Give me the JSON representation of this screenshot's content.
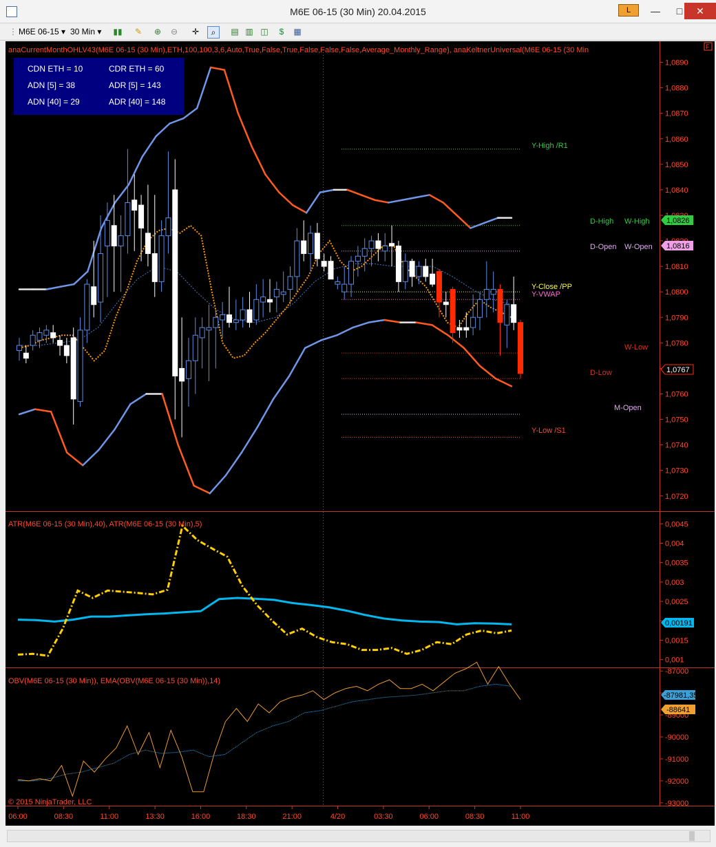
{
  "window": {
    "title": "M6E 06-15 (30 Min)  20.04.2015",
    "minimize": "—",
    "maximize": "□",
    "close": "✕",
    "lock_label": "L"
  },
  "toolbar": {
    "instrument": "M6E 06-15",
    "interval": "30 Min"
  },
  "legend": {
    "price": "anaCurrentMonthOHLV43(M6E  06-15 (30 Min),ETH,100,100,3,6,Auto,True,False,True,False,False,False,Average_Monthly_Range), anaKeltnerUniversal(M6E  06-15 (30 Min",
    "atr": "ATR(M6E 06-15 (30 Min),40), ATR(M6E 06-15 (30 Min),5)",
    "obv": "OBV(M6E 06-15 (30 Min)), EMA(OBV(M6E 06-15 (30 Min)),14)",
    "copyright": "© 2015 NinjaTrader, LLC",
    "f_box": "F"
  },
  "info_box": {
    "cdn_eth": "CDN ETH = 10",
    "cdr_eth": "CDR ETH = 60",
    "adn5": "ADN [5] = 38",
    "adr5": "ADR [5] = 143",
    "adn40": "ADN [40] = 29",
    "adr40": "ADR [40] = 148"
  },
  "level_labels": {
    "y_high": "Y-High /R1",
    "d_high": "D-High",
    "w_high": "W-High",
    "d_open": "D-Open",
    "w_open": "W-Open",
    "y_close": "Y-Close /PP",
    "y_vwap": "Y-VWAP",
    "w_low": "W-Low",
    "d_low": "D-Low",
    "m_open": "M-Open",
    "y_low": "Y-Low /S1"
  },
  "price_tags": {
    "high": "1,0826",
    "open": "1,0816",
    "last": "1,0767"
  },
  "atr_tag": "0,00191",
  "obv_tags": {
    "obv": "-88641",
    "ema": "-87981,35"
  },
  "colors": {
    "background": "#000000",
    "bull_candle": "#5b8ee6",
    "bear_candle": "#ffffff",
    "red_candle": "#ff2a00",
    "keltner_up": "#6f96e8",
    "keltner_down": "#ff5a20",
    "keltner_neutral": "#e8e8e8",
    "atr40": "#00b8f0",
    "atr5": "#ffd000",
    "obv": "#e89a30",
    "obv_ema": "#3aa0d8",
    "separator": "#c0392b"
  },
  "chart_data": [
    {
      "type": "candlestick",
      "title": "M6E 06-15 (30 Min)",
      "x_tick_labels": [
        "06:00",
        "08:30",
        "11:00",
        "13:30",
        "16:00",
        "18:30",
        "21:00",
        "4/20",
        "03:30",
        "06:00",
        "08:30",
        "11:00"
      ],
      "y_ticks": [
        "1,0890",
        "1,0880",
        "1,0870",
        "1,0860",
        "1,0850",
        "1,0840",
        "1,0830",
        "1,0820",
        "1,0810",
        "1,0800",
        "1,0790",
        "1,0780",
        "1,0770",
        "1,0760",
        "1,0750",
        "1,0740",
        "1,0730",
        "1,0720"
      ],
      "ylim": [
        1.0714,
        1.0895
      ],
      "candles_ohlc": [
        [
          1.0777,
          1.0782,
          1.0773,
          1.0779
        ],
        [
          1.0776,
          1.0779,
          1.0772,
          1.0774
        ],
        [
          1.0779,
          1.0785,
          1.0777,
          1.0783
        ],
        [
          1.0781,
          1.0786,
          1.0778,
          1.0784
        ],
        [
          1.0783,
          1.0787,
          1.078,
          1.0785
        ],
        [
          1.0784,
          1.0787,
          1.078,
          1.0782
        ],
        [
          1.0781,
          1.0783,
          1.0775,
          1.0779
        ],
        [
          1.0779,
          1.0782,
          1.0772,
          1.0775
        ],
        [
          1.0782,
          1.0786,
          1.0748,
          1.0758
        ],
        [
          1.0757,
          1.079,
          1.0755,
          1.0785
        ],
        [
          1.0785,
          1.0805,
          1.078,
          1.0803
        ],
        [
          1.0802,
          1.082,
          1.079,
          1.0795
        ],
        [
          1.0796,
          1.083,
          1.0788,
          1.0815
        ],
        [
          1.0818,
          1.0835,
          1.0798,
          1.0828
        ],
        [
          1.0826,
          1.0838,
          1.08,
          1.0818
        ],
        [
          1.0818,
          1.083,
          1.08,
          1.0822
        ],
        [
          1.0822,
          1.0856,
          1.0815,
          1.0835
        ],
        [
          1.0836,
          1.0846,
          1.0816,
          1.0832
        ],
        [
          1.0834,
          1.0838,
          1.0812,
          1.0825
        ],
        [
          1.0823,
          1.0842,
          1.081,
          1.0815
        ],
        [
          1.0815,
          1.0838,
          1.0798,
          1.0804
        ],
        [
          1.0804,
          1.0828,
          1.08,
          1.0822
        ],
        [
          1.0822,
          1.0855,
          1.0815,
          1.0829
        ],
        [
          1.084,
          1.0852,
          1.075,
          1.0767
        ],
        [
          1.077,
          1.079,
          1.0743,
          1.0765
        ],
        [
          1.0766,
          1.0782,
          1.0755,
          1.0773
        ],
        [
          1.0773,
          1.079,
          1.076,
          1.0783
        ],
        [
          1.0782,
          1.079,
          1.077,
          1.0786
        ],
        [
          1.0785,
          1.0795,
          1.0765,
          1.0786
        ],
        [
          1.0786,
          1.0793,
          1.077,
          1.079
        ],
        [
          1.0789,
          1.0796,
          1.0782,
          1.0791
        ],
        [
          1.0791,
          1.0802,
          1.0786,
          1.0788
        ],
        [
          1.0788,
          1.0797,
          1.0785,
          1.0789
        ],
        [
          1.0789,
          1.0798,
          1.0786,
          1.0793
        ],
        [
          1.0793,
          1.08,
          1.0786,
          1.0788
        ],
        [
          1.0789,
          1.0803,
          1.0787,
          1.0797
        ],
        [
          1.0796,
          1.0805,
          1.079,
          1.0798
        ],
        [
          1.0797,
          1.0805,
          1.0792,
          1.0796
        ],
        [
          1.0798,
          1.0804,
          1.0792,
          1.0801
        ],
        [
          1.0799,
          1.0808,
          1.0796,
          1.08
        ],
        [
          1.0801,
          1.081,
          1.0795,
          1.0806
        ],
        [
          1.0806,
          1.0825,
          1.08,
          1.082
        ],
        [
          1.082,
          1.0828,
          1.0812,
          1.0815
        ],
        [
          1.0815,
          1.0826,
          1.0808,
          1.0823
        ],
        [
          1.0823,
          1.0827,
          1.081,
          1.0813
        ],
        [
          1.0812,
          1.0815,
          1.0808,
          1.081
        ],
        [
          1.0812,
          1.0814,
          1.0805,
          1.0805
        ],
        [
          1.0803,
          1.0806,
          1.0801,
          1.0804
        ],
        [
          1.08,
          1.081,
          1.0797,
          1.0803
        ],
        [
          1.0803,
          1.0814,
          1.0798,
          1.0812
        ],
        [
          1.0812,
          1.0818,
          1.0806,
          1.0814
        ],
        [
          1.0814,
          1.0821,
          1.0808,
          1.0817
        ],
        [
          1.0817,
          1.0822,
          1.081,
          1.082
        ],
        [
          1.082,
          1.0823,
          1.0812,
          1.0817
        ],
        [
          1.0816,
          1.0823,
          1.0812,
          1.0818
        ],
        [
          1.0819,
          1.0826,
          1.081,
          1.0818
        ],
        [
          1.0818,
          1.082,
          1.08,
          1.0804
        ],
        [
          1.0804,
          1.0815,
          1.0801,
          1.0812
        ],
        [
          1.0812,
          1.0813,
          1.0802,
          1.0806
        ],
        [
          1.0806,
          1.0812,
          1.0803,
          1.081
        ],
        [
          1.081,
          1.0813,
          1.0804,
          1.0806
        ],
        [
          1.0807,
          1.0813,
          1.0802,
          1.0803
        ],
        [
          1.0808,
          1.0809,
          1.079,
          1.0796
        ],
        [
          1.0796,
          1.08,
          1.079,
          1.0795
        ],
        [
          1.0801,
          1.0802,
          1.078,
          1.0784
        ],
        [
          1.0786,
          1.0789,
          1.0782,
          1.0785
        ],
        [
          1.0786,
          1.0792,
          1.0782,
          1.0785
        ],
        [
          1.0786,
          1.0799,
          1.0783,
          1.079
        ],
        [
          1.079,
          1.08,
          1.0785,
          1.0797
        ],
        [
          1.0797,
          1.0812,
          1.079,
          1.0801
        ],
        [
          1.0799,
          1.0808,
          1.0792,
          1.0801
        ],
        [
          1.0801,
          1.0803,
          1.0775,
          1.0788
        ],
        [
          1.0787,
          1.0797,
          1.0778,
          1.0795
        ],
        [
          1.0795,
          1.0806,
          1.0785,
          1.0788
        ],
        [
          1.0788,
          1.0789,
          1.0766,
          1.0768
        ]
      ],
      "levels": {
        "y_high": 1.0856,
        "d_high": 1.0826,
        "w_high": 1.0826,
        "d_open": 1.0816,
        "w_open": 1.0816,
        "y_close": 1.08,
        "y_vwap": 1.0797,
        "w_low": 1.0776,
        "d_low": 1.0766,
        "m_open": 1.0752,
        "y_low": 1.0743
      },
      "keltner_upper": [
        1.0801,
        1.0801,
        1.0801,
        1.0802,
        1.0803,
        1.0808,
        1.0825,
        1.0835,
        1.0842,
        1.0853,
        1.0861,
        1.0866,
        1.0868,
        1.0872,
        1.0888,
        1.0887,
        1.087,
        1.0857,
        1.0846,
        1.0839,
        1.0834,
        1.0831,
        1.0839,
        1.084,
        1.084,
        1.0838,
        1.0836,
        1.0835,
        1.0836,
        1.0837,
        1.0838,
        1.0835,
        1.083,
        1.0825,
        1.0827,
        1.0829,
        1.0829
      ],
      "keltner_lower": [
        1.0752,
        1.0754,
        1.0753,
        1.0737,
        1.0732,
        1.0738,
        1.0746,
        1.0756,
        1.076,
        1.076,
        1.074,
        1.0724,
        1.0721,
        1.0728,
        1.0737,
        1.0747,
        1.0758,
        1.0767,
        1.0778,
        1.0781,
        1.0783,
        1.0786,
        1.0788,
        1.0789,
        1.0788,
        1.0788,
        1.0787,
        1.0783,
        1.0778,
        1.0771,
        1.0766,
        1.0763
      ],
      "ema_fast": [
        1.0778,
        1.0779,
        1.0781,
        1.0782,
        1.0783,
        1.0783,
        1.0778,
        1.0773,
        1.0777,
        1.079,
        1.08,
        1.0812,
        1.082,
        1.0824,
        1.0825,
        1.0823,
        1.0826,
        1.0822,
        1.08,
        1.078,
        1.0774,
        1.0775,
        1.078,
        1.0784,
        1.0789,
        1.0794,
        1.08,
        1.0806,
        1.0815,
        1.082,
        1.0812,
        1.0808,
        1.081,
        1.0814,
        1.0818,
        1.0818,
        1.081,
        1.0806,
        1.0802,
        1.0795,
        1.0788,
        1.0786,
        1.0792,
        1.0797,
        1.0794,
        1.0792,
        1.079
      ],
      "ema_slow": [
        1.0779,
        1.0779,
        1.078,
        1.0781,
        1.0786,
        1.0796,
        1.0805,
        1.081,
        1.0808,
        1.08,
        1.0793,
        1.0789,
        1.0788,
        1.079,
        1.0796,
        1.0804,
        1.0809,
        1.0811,
        1.0811,
        1.081,
        1.081,
        1.081,
        1.0806,
        1.0801,
        1.0797,
        1.0795
      ]
    },
    {
      "type": "line",
      "title": "ATR",
      "y_ticks": [
        "0,0045",
        "0,004",
        "0,0035",
        "0,003",
        "0,0025",
        "0,002",
        "0,0015",
        "0,001"
      ],
      "ylim": [
        0.0008,
        0.0047
      ],
      "series": [
        {
          "name": "ATR(M6E 06-15 (30 Min),40)",
          "values": [
            0.00203,
            0.00202,
            0.00198,
            0.00203,
            0.00211,
            0.00211,
            0.00214,
            0.00217,
            0.00219,
            0.00222,
            0.00225,
            0.00256,
            0.00259,
            0.00257,
            0.00254,
            0.00246,
            0.00241,
            0.00235,
            0.00226,
            0.00215,
            0.00206,
            0.00201,
            0.00198,
            0.00197,
            0.00191,
            0.00194,
            0.00193,
            0.00191
          ]
        },
        {
          "name": "ATR(M6E 06-15 (30 Min),5)",
          "values": [
            0.00113,
            0.00115,
            0.0011,
            0.0018,
            0.00278,
            0.00259,
            0.00278,
            0.00275,
            0.00272,
            0.00268,
            0.0028,
            0.00445,
            0.00408,
            0.00386,
            0.00365,
            0.0029,
            0.0024,
            0.002,
            0.00165,
            0.0018,
            0.00158,
            0.00145,
            0.0014,
            0.00125,
            0.00125,
            0.0013,
            0.00115,
            0.00125,
            0.00145,
            0.0014,
            0.00165,
            0.00175,
            0.00168,
            0.00175
          ]
        }
      ]
    },
    {
      "type": "line",
      "title": "OBV",
      "y_ticks": [
        "-87000",
        "-88000",
        "-89000",
        "-90000",
        "-91000",
        "-92000",
        "-93000"
      ],
      "ylim": [
        -93100,
        -86900
      ],
      "series": [
        {
          "name": "OBV(M6E 06-15 (30 Min))",
          "values": [
            -91950,
            -92000,
            -91900,
            -92000,
            -91300,
            -92700,
            -91100,
            -91600,
            -91000,
            -90500,
            -89500,
            -90800,
            -89800,
            -91400,
            -89700,
            -90900,
            -92500,
            -92500,
            -90700,
            -89300,
            -88700,
            -89300,
            -88500,
            -88900,
            -88400,
            -88200,
            -88100,
            -87900,
            -88300,
            -88000,
            -87800,
            -87700,
            -87900,
            -87600,
            -87400,
            -87800,
            -87800,
            -87600,
            -87900,
            -87500,
            -87100,
            -86900,
            -86600,
            -87600,
            -86800,
            -87600,
            -88300
          ]
        },
        {
          "name": "EMA(OBV(M6E 06-15 (30 Min)),14)",
          "values": [
            -92000,
            -92000,
            -91900,
            -91700,
            -91600,
            -91400,
            -91200,
            -90800,
            -90600,
            -90750,
            -90700,
            -90600,
            -90900,
            -90800,
            -90300,
            -89800,
            -89500,
            -89300,
            -88900,
            -88800,
            -88600,
            -88400,
            -88300,
            -88200,
            -88150,
            -88100,
            -88000,
            -87900,
            -87900,
            -87700,
            -87600,
            -87700
          ]
        }
      ]
    }
  ]
}
